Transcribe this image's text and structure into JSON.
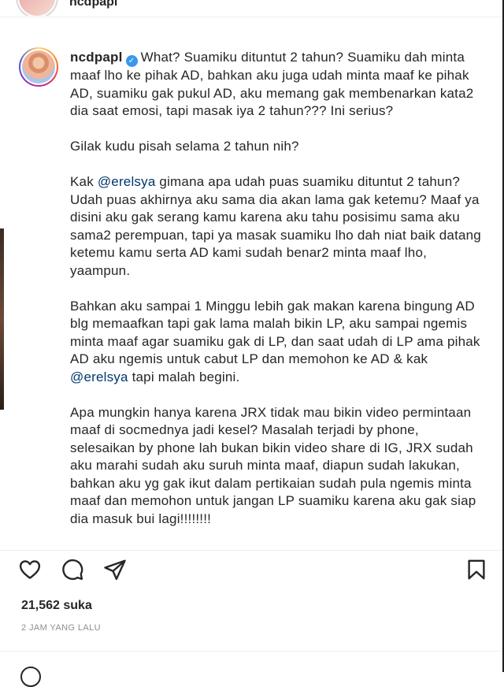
{
  "header_prev": {
    "username": "ncdpapl"
  },
  "post": {
    "username": "ncdpapl",
    "verified_glyph": "✓",
    "paragraphs": {
      "p1": "What? Suamiku dituntut 2 tahun? Suamiku dah minta maaf lho ke pihak AD, bahkan aku juga udah minta maaf ke pihak AD, suamiku gak pukul AD, aku memang gak membenarkan kata2 dia saat emosi, tapi masak iya 2 tahun??? Ini serius?",
      "p2": "Gilak kudu pisah selama 2 tahun nih?",
      "p3_pre": "Kak ",
      "p3_mention": "@erelsya",
      "p3_post": " gimana apa udah puas suamiku dituntut 2 tahun? Udah puas akhirnya aku sama dia akan lama gak ketemu? Maaf ya disini aku gak serang kamu karena aku tahu posisimu sama aku sama2 perempuan, tapi ya masak suamiku lho dah niat baik datang ketemu kamu serta AD kami sudah benar2 minta maaf lho, yaampun.",
      "p4_pre": "Bahkan aku sampai 1 Minggu lebih gak makan karena bingung AD blg memaafkan tapi gak lama malah bikin LP, aku sampai ngemis minta maaf agar suamiku gak di LP, dan saat udah di LP ama pihak AD aku ngemis untuk cabut LP dan memohon ke AD & kak ",
      "p4_mention": "@erelsya",
      "p4_post": " tapi malah begini.",
      "p5": "Apa mungkin hanya karena JRX tidak mau bikin video permintaan maaf di socmednya jadi kesel? Masalah terjadi by phone, selesaikan by phone lah bukan bikin video share di IG, JRX sudah aku marahi sudah aku suruh minta maaf, diapun sudah lakukan, bahkan aku yg gak ikut dalam pertikaian sudah pula ngemis minta maaf dan memohon untuk jangan LP suamiku karena aku gak siap dia masuk bui lagi!!!!!!!!"
    }
  },
  "actions": {
    "icons": [
      "heart-icon",
      "comment-icon",
      "share-icon",
      "bookmark-icon"
    ]
  },
  "stats": {
    "likes": "21,562 suka",
    "time": "2 JAM YANG LALU"
  },
  "colors": {
    "text": "#262626",
    "mention": "#00376b",
    "verified": "#3897f0",
    "muted": "#8e8e8e"
  }
}
